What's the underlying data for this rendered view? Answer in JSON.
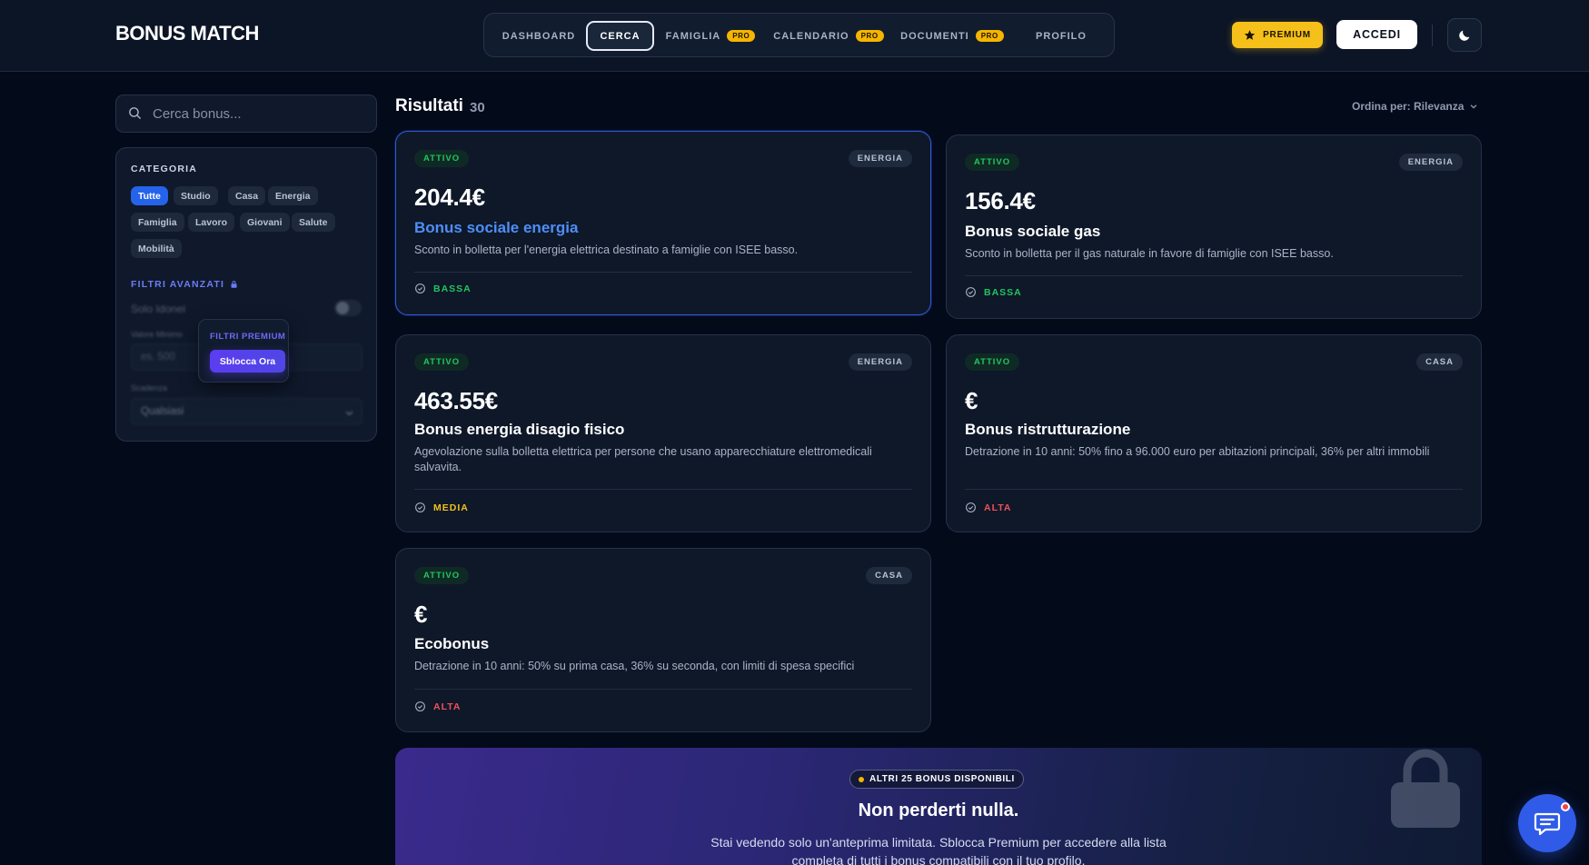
{
  "app": {
    "logo": "BONUS MATCH"
  },
  "nav": [
    {
      "label": "DASHBOARD",
      "pro": ""
    },
    {
      "label": "CERCA",
      "pro": ""
    },
    {
      "label": "FAMIGLIA",
      "pro": "PRO"
    },
    {
      "label": "CALENDARIO",
      "pro": "PRO"
    },
    {
      "label": "DOCUMENTI",
      "pro": "PRO"
    },
    {
      "label": "PROFILO",
      "pro": ""
    }
  ],
  "header": {
    "premium_label": "PREMIUM",
    "login_label": "ACCEDI"
  },
  "search": {
    "placeholder": "Cerca bonus..."
  },
  "filters": {
    "category_title": "CATEGORIA",
    "categories": [
      "Tutte",
      "Studio",
      "Casa",
      "Energia",
      "Famiglia",
      "Lavoro",
      "Giovani",
      "Salute",
      "Mobilità"
    ],
    "active_category": "Tutte",
    "advanced_title": "FILTRI AVANZATI",
    "only_eligible": "Solo Idonei",
    "min_value_label": "Valore Minimo",
    "min_value_placeholder": "es. 500",
    "deadline_label": "Scadenza",
    "deadline_value": "Qualsiasi",
    "premium_popup_title": "FILTRI PREMIUM",
    "premium_popup_button": "Sblocca Ora"
  },
  "results": {
    "title": "Risultati",
    "count": "30",
    "sort_label": "Ordina per: Rilevanza",
    "cards": [
      {
        "status": "ATTIVO",
        "category": "ENERGIA",
        "amount": "204.4€",
        "title": "Bonus sociale energia",
        "description": "Sconto in bolletta per l'energia elettrica destinato a famiglie con ISEE basso.",
        "level": "BASSA"
      },
      {
        "status": "ATTIVO",
        "category": "ENERGIA",
        "amount": "156.4€",
        "title": "Bonus sociale gas",
        "description": "Sconto in bolletta per il gas naturale in favore di famiglie con ISEE basso.",
        "level": "BASSA"
      },
      {
        "status": "ATTIVO",
        "category": "ENERGIA",
        "amount": "463.55€",
        "title": "Bonus energia disagio fisico",
        "description": "Agevolazione sulla bolletta elettrica per persone che usano apparecchiature elettromedicali salvavita.",
        "level": "MEDIA"
      },
      {
        "status": "ATTIVO",
        "category": "CASA",
        "amount": "€",
        "title": "Bonus ristrutturazione",
        "description": "Detrazione in 10 anni: 50% fino a 96.000 euro per abitazioni principali, 36% per altri immobili",
        "level": "ALTA"
      },
      {
        "status": "ATTIVO",
        "category": "CASA",
        "amount": "€",
        "title": "Ecobonus",
        "description": "Detrazione in 10 anni: 50% su prima casa, 36% su seconda, con limiti di spesa specifici",
        "level": "ALTA"
      }
    ]
  },
  "promo": {
    "badge": "ALTRI 25 BONUS DISPONIBILI",
    "title": "Non perderti nulla.",
    "text": "Stai vedendo solo un'anteprima limitata. Sblocca Premium per accedere alla lista completa di tutti i bonus compatibili con il tuo profilo."
  },
  "icons": {
    "search": "search-icon",
    "moon": "moon-icon",
    "star": "star-icon",
    "lock": "lock-icon",
    "check": "check-circle-icon",
    "chevron": "chevron-down-icon",
    "chat": "chat-icon"
  },
  "colors": {
    "accent": "#2563eb",
    "premium": "#f5c01a",
    "pro_badge": "#f5b500",
    "status_green": "#22c55e",
    "level_media": "#f5c01a",
    "level_alta": "#f0505a",
    "link": "#4f8ef7"
  }
}
